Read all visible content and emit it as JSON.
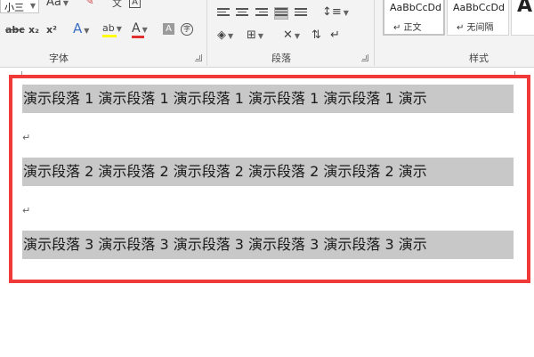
{
  "ribbon": {
    "font_group": {
      "label": "字体",
      "font_size": "小三",
      "case_label": "Aa",
      "wen_label": "文",
      "char_border_label": "A",
      "large_a_label": "A",
      "strike_label": "abc",
      "sub_label": "x₂",
      "sup_label": "x²",
      "effects_label": "A",
      "highlight_label": "ab",
      "font_color_label": "A",
      "shading_label": "A",
      "enclose_label": "字",
      "highlight_color": "#ffff00",
      "font_color": "#e03030"
    },
    "paragraph_group": {
      "label": "段落"
    },
    "styles_group": {
      "label": "样式",
      "items": [
        {
          "sample": "AaBbCcDd",
          "name": "↵ 正文"
        },
        {
          "sample": "AaBbCcDd",
          "name": "↵ 无间隔"
        },
        {
          "sample": "A"
        }
      ]
    }
  },
  "document": {
    "paragraphs": [
      "演示段落 1 演示段落 1 演示段落 1 演示段落 1 演示段落 1 演示",
      "演示段落 2 演示段落 2 演示段落 2 演示段落 2 演示段落 2 演示",
      "演示段落 3 演示段落 3 演示段落 3 演示段落 3 演示段落 3 演示"
    ],
    "paragraph_mark": "↵",
    "frame_color": "#f03a3a",
    "selection_color": "#c8c8c8"
  }
}
